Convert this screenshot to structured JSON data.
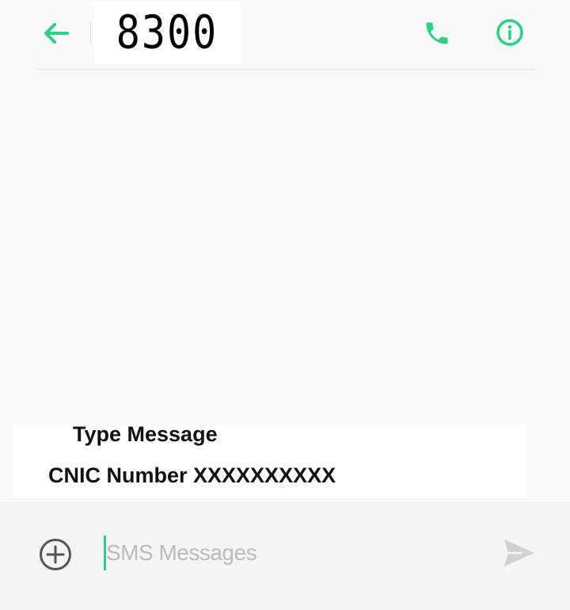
{
  "header": {
    "title": "8300"
  },
  "overlay_note": {
    "line1": "Type Message",
    "line2": "CNIC Number XXXXXXXXXX"
  },
  "compose": {
    "placeholder": "SMS Messages",
    "value": ""
  },
  "icons": {
    "back": "arrow-left-icon",
    "call": "phone-icon",
    "info": "info-icon",
    "attach": "plus-circle-icon",
    "send": "send-icon"
  },
  "colors": {
    "accent": "#2ecf85",
    "icon_gray": "#555555",
    "send_disabled": "#cfd3d2",
    "background": "#f8faf9"
  }
}
